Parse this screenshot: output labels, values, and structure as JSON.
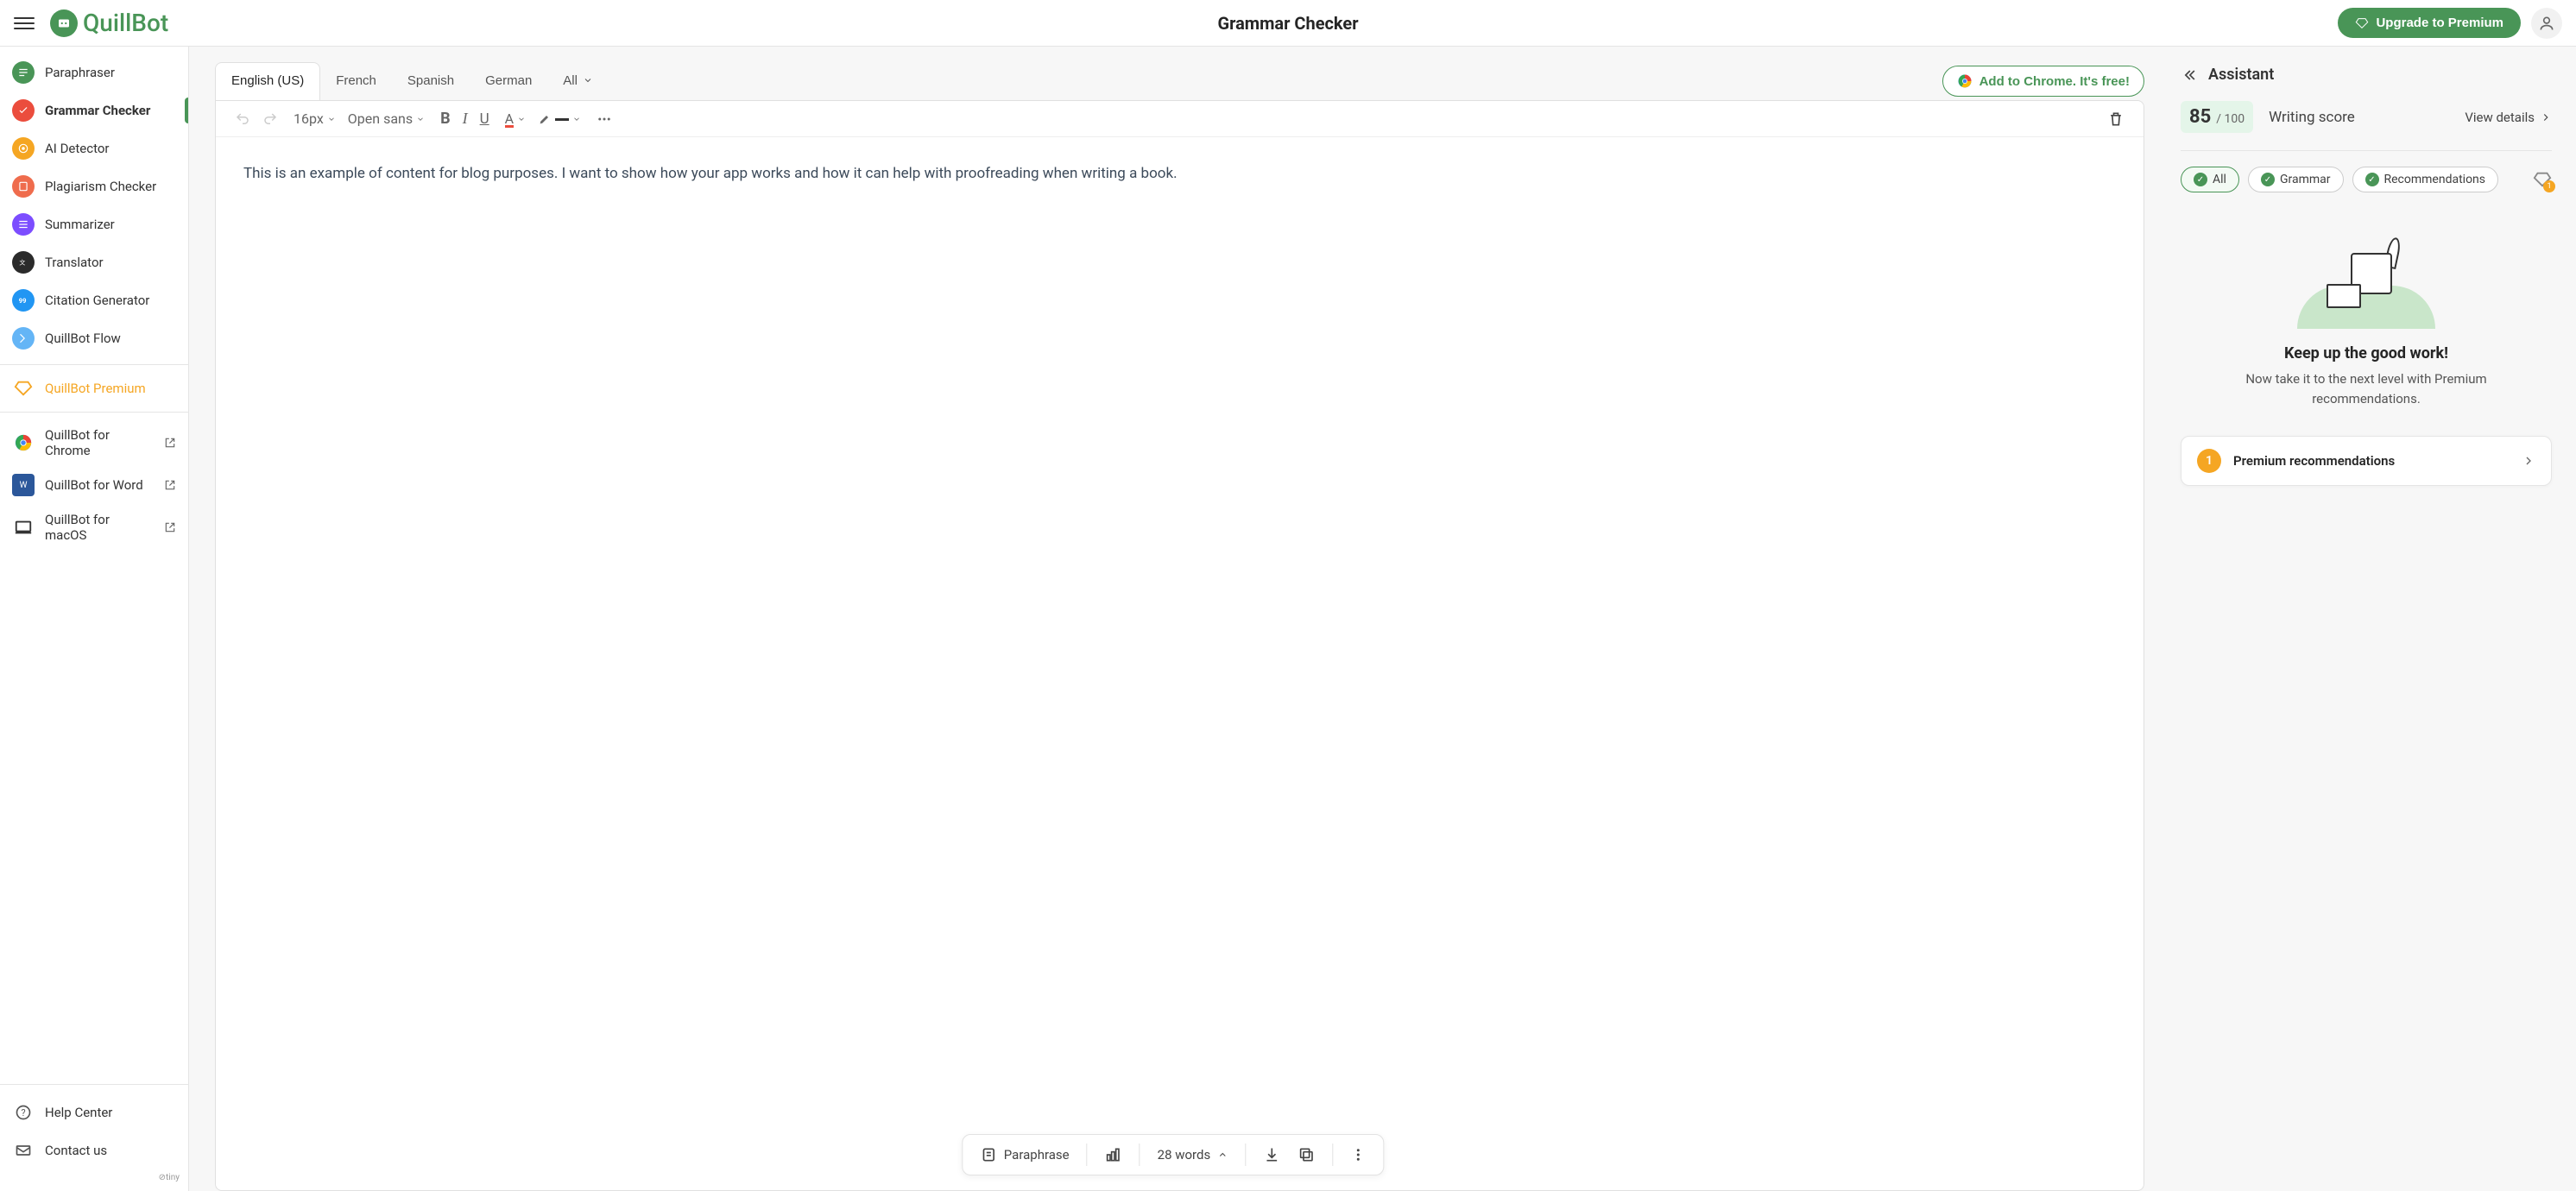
{
  "header": {
    "logo_text": "QuillBot",
    "title": "Grammar Checker",
    "upgrade": "Upgrade to Premium"
  },
  "sidebar": {
    "items": [
      {
        "label": "Paraphraser"
      },
      {
        "label": "Grammar Checker"
      },
      {
        "label": "AI Detector"
      },
      {
        "label": "Plagiarism Checker"
      },
      {
        "label": "Summarizer"
      },
      {
        "label": "Translator"
      },
      {
        "label": "Citation Generator"
      },
      {
        "label": "QuillBot Flow"
      }
    ],
    "premium": "QuillBot Premium",
    "integrations": [
      {
        "label": "QuillBot for Chrome"
      },
      {
        "label": "QuillBot for Word"
      },
      {
        "label": "QuillBot for macOS"
      }
    ],
    "footer": [
      {
        "label": "Help Center"
      },
      {
        "label": "Contact us"
      }
    ],
    "tiny": "tiny"
  },
  "tabs": {
    "items": [
      "English (US)",
      "French",
      "Spanish",
      "German",
      "All"
    ],
    "add_chrome": "Add to Chrome. It's free!"
  },
  "toolbar": {
    "font_size": "16px",
    "font_family": "Open sans"
  },
  "editor": {
    "text": "This is an example of content for blog purposes. I want to show how your app works and how it can help with proofreading when writing a book."
  },
  "bottom": {
    "paraphrase": "Paraphrase",
    "word_count": "28 words"
  },
  "assistant": {
    "title": "Assistant",
    "score": "85",
    "score_sep": "/",
    "score_max": "100",
    "score_label": "Writing score",
    "view_details": "View details",
    "chips": [
      "All",
      "Grammar",
      "Recommendations"
    ],
    "diamond_badge": "1",
    "empty_title": "Keep up the good work!",
    "empty_sub": "Now take it to the next level with Premium recommendations.",
    "rec_count": "1",
    "rec_text": "Premium recommendations"
  }
}
